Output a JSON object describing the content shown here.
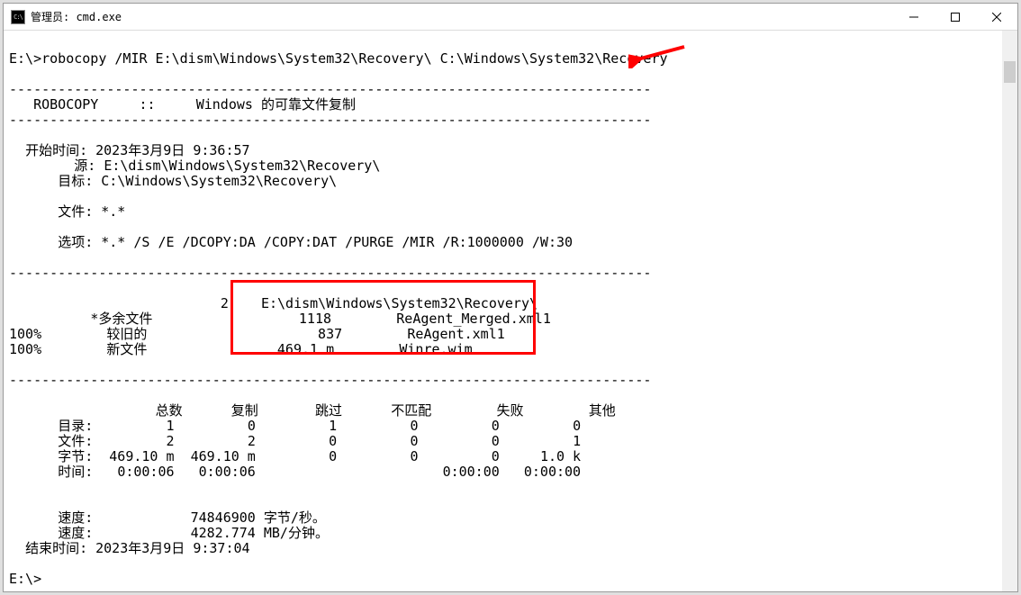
{
  "window": {
    "title": "管理员: cmd.exe",
    "icon_glyph": "C:\\"
  },
  "prompt": "E:\\>",
  "command": "robocopy /MIR E:\\dism\\Windows\\System32\\Recovery\\ C:\\Windows\\System32\\Recovery",
  "dashes_long": "-------------------------------------------------------------------------------",
  "header_label": "ROBOCOPY",
  "header_sep": "::",
  "header_desc": "Windows 的可靠文件复制",
  "start_time_label": "开始时间:",
  "start_time_value": "2023年3月9日 9:36:57",
  "source_label": "源:",
  "source_value": "E:\\dism\\Windows\\System32\\Recovery\\",
  "dest_label": "目标:",
  "dest_value": "C:\\Windows\\System32\\Recovery\\",
  "files_label": "文件:",
  "files_value": "*.*",
  "options_label": "选项:",
  "options_value": "*.* /S /E /DCOPY:DA /COPY:DAT /PURGE /MIR /R:1000000 /W:30",
  "dir_count": "2",
  "dir_path": "E:\\dism\\Windows\\System32\\Recovery\\",
  "extra_file_label": "*多余文件",
  "extra_file_size": "1118",
  "extra_file_name": "ReAgent_Merged.xml1",
  "percent_100_a": "100%",
  "older_label": "较旧的",
  "older_size": "837",
  "older_name": "ReAgent.xml1",
  "percent_100_b": "100%",
  "newfile_label": "新文件",
  "newfile_size": "469.1 m",
  "newfile_name": "Winre.wim",
  "stats_header": {
    "total": "总数",
    "copied": "复制",
    "skipped": "跳过",
    "mismatch": "不匹配",
    "failed": "失败",
    "other": "其他"
  },
  "stats_rows": {
    "dirs": {
      "label": "目录:",
      "c1": "1",
      "c2": "0",
      "c3": "1",
      "c4": "0",
      "c5": "0",
      "c6": "0"
    },
    "files": {
      "label": "文件:",
      "c1": "2",
      "c2": "2",
      "c3": "0",
      "c4": "0",
      "c5": "0",
      "c6": "1"
    },
    "bytes": {
      "label": "字节:",
      "c1": "469.10 m",
      "c2": "469.10 m",
      "c3": "0",
      "c4": "0",
      "c5": "0",
      "c6": "1.0 k"
    },
    "time": {
      "label": "时间:",
      "c1": "0:00:06",
      "c2": "0:00:06",
      "c3": "",
      "c4": "",
      "c5": "0:00:00",
      "c6": "0:00:00"
    }
  },
  "speed1_label": "速度:",
  "speed1_value": "74846900 字节/秒。",
  "speed2_label": "速度:",
  "speed2_value": "4282.774 MB/分钟。",
  "end_time_label": "结束时间:",
  "end_time_value": "2023年3月9日 9:37:04",
  "prompt2": "E:\\>",
  "colors": {
    "red": "#ff0000",
    "black": "#000000",
    "white": "#ffffff"
  }
}
